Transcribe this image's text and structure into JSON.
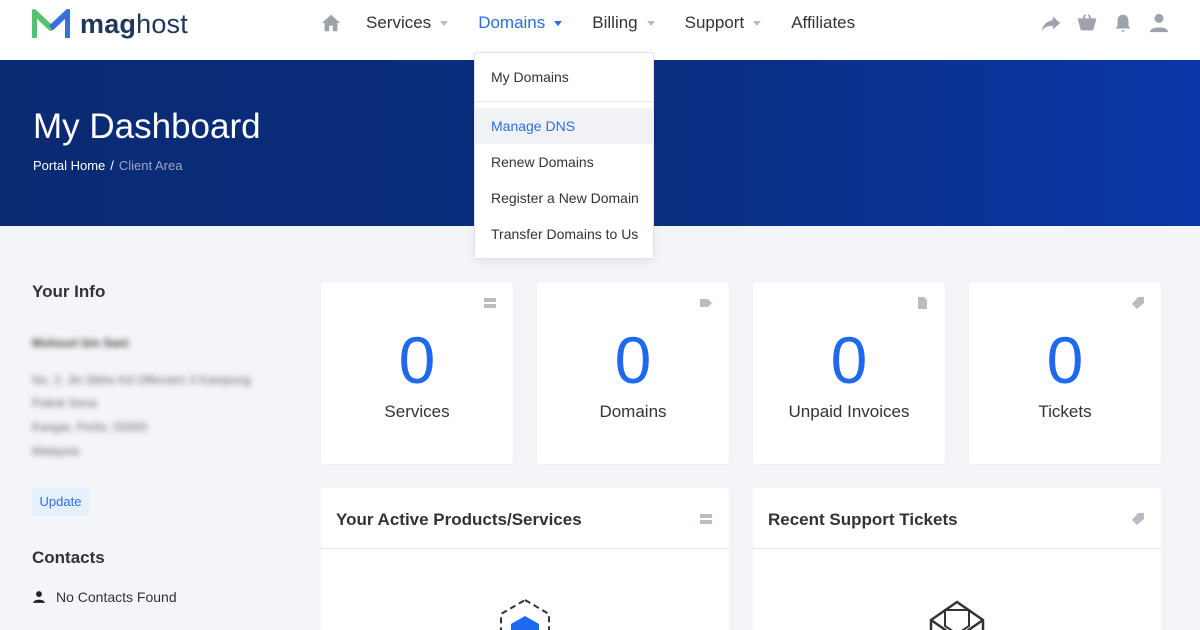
{
  "brand": {
    "name_bold": "mag",
    "name_light": "host",
    "colors": {
      "green": "#56c271",
      "blue": "#3571d8",
      "accent": "#2a6ee6",
      "navy": "#0b2f84"
    }
  },
  "nav": {
    "home_icon": "home-icon",
    "items": [
      {
        "label": "Services",
        "has_caret": true
      },
      {
        "label": "Domains",
        "has_caret": true,
        "active": true
      },
      {
        "label": "Billing",
        "has_caret": true
      },
      {
        "label": "Support",
        "has_caret": true
      },
      {
        "label": "Affiliates",
        "has_caret": false
      }
    ],
    "right_icons": [
      "share-icon",
      "cart-icon",
      "bell-icon",
      "user-icon"
    ]
  },
  "domains_menu": {
    "items": [
      {
        "label": "My Domains"
      },
      {
        "label": "Manage DNS",
        "highlighted": true
      },
      {
        "label": "Renew Domains"
      },
      {
        "label": "Register a New Domain"
      },
      {
        "label": "Transfer Domains to Us"
      }
    ]
  },
  "hero": {
    "title": "My Dashboard",
    "breadcrumb": {
      "home": "Portal Home",
      "separator": "/",
      "current": "Client Area"
    }
  },
  "sidebar": {
    "your_info_title": "Your Info",
    "info_lines": [
      "Mohsuri bin Sani",
      "No. 2, Jln Sikhs Kd Offenstrn 3 Kampung",
      "Pokok Sena",
      "Kangar, Perlis, 02600",
      "Malaysia"
    ],
    "update_label": "Update",
    "contacts_title": "Contacts",
    "no_contacts": "No Contacts Found"
  },
  "stats": [
    {
      "count": "0",
      "label": "Services",
      "icon": "server-icon"
    },
    {
      "count": "0",
      "label": "Domains",
      "icon": "tag-icon"
    },
    {
      "count": "0",
      "label": "Unpaid Invoices",
      "icon": "document-icon"
    },
    {
      "count": "0",
      "label": "Tickets",
      "icon": "ticket-icon"
    }
  ],
  "panels": {
    "products": {
      "title": "Your Active Products/Services",
      "icon": "server-icon"
    },
    "tickets": {
      "title": "Recent Support Tickets",
      "icon": "ticket-icon"
    }
  }
}
